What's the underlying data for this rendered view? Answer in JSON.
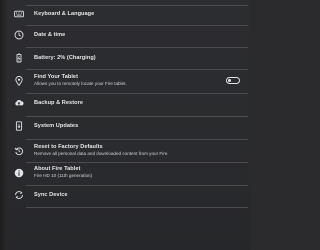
{
  "settings": {
    "items": [
      {
        "title": "Keyboard & Language",
        "subtitle": "",
        "icon": "keyboard-icon"
      },
      {
        "title": "Date & time",
        "subtitle": "",
        "icon": "clock-icon"
      },
      {
        "title": "Battery: 2% (Charging)",
        "subtitle": "",
        "icon": "battery-icon"
      },
      {
        "title": "Find Your Tablet",
        "subtitle": "Allows you to remotely locate your Fire tablet.",
        "icon": "location-pin-icon",
        "toggle": "off"
      },
      {
        "title": "Backup & Restore",
        "subtitle": "",
        "icon": "cloud-icon"
      },
      {
        "title": "System Updates",
        "subtitle": "",
        "icon": "system-update-icon"
      },
      {
        "title": "Reset to Factory Defaults",
        "subtitle": "Remove all personal data and downloaded content from your Fire.",
        "icon": "reset-icon"
      },
      {
        "title": "About Fire Tablet",
        "subtitle": "Fire HD 10 (11th generation)",
        "icon": "info-icon"
      },
      {
        "title": "Sync Device",
        "subtitle": "",
        "icon": "sync-icon"
      }
    ]
  },
  "colors": {
    "background": "#2b2c2f",
    "text": "#e9e9ea",
    "divider": "#4b4c50"
  }
}
